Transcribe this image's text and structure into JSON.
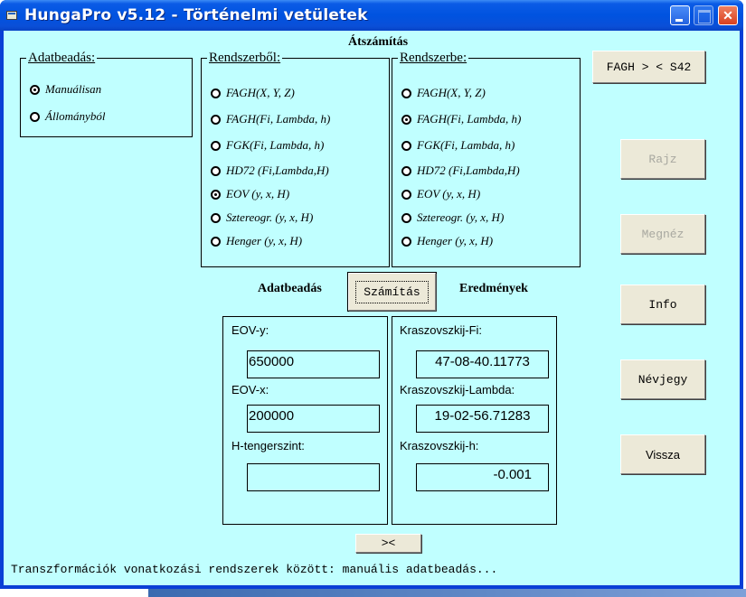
{
  "window": {
    "title": "HungaPro v5.12 - Történelmi vetületek",
    "controls": {
      "minimize": "minimize",
      "maximize": "maximize",
      "close": "close"
    }
  },
  "header": {
    "title": "Átszámítás"
  },
  "input_mode": {
    "legend": "Adatbeadás:",
    "options": [
      {
        "label": "Manuálisan",
        "checked": true
      },
      {
        "label": "Állományból",
        "checked": false
      }
    ]
  },
  "from_system": {
    "legend": "Rendszerből:",
    "options": [
      {
        "label": "FAGH(X, Y, Z)",
        "checked": false
      },
      {
        "label": "FAGH(Fi, Lambda, h)",
        "checked": false
      },
      {
        "label": "FGK(Fi, Lambda, h)",
        "checked": false
      },
      {
        "label": "HD72 (Fi,Lambda,H)",
        "checked": false
      },
      {
        "label": "EOV (y, x, H)",
        "checked": true
      },
      {
        "label": "Sztereogr. (y, x, H)",
        "checked": false
      },
      {
        "label": "Henger (y, x, H)",
        "checked": false
      }
    ]
  },
  "to_system": {
    "legend": "Rendszerbe:",
    "options": [
      {
        "label": "FAGH(X, Y, Z)",
        "checked": false
      },
      {
        "label": "FAGH(Fi, Lambda, h)",
        "checked": true
      },
      {
        "label": "FGK(Fi, Lambda, h)",
        "checked": false
      },
      {
        "label": "HD72 (Fi,Lambda,H)",
        "checked": false
      },
      {
        "label": "EOV (y, x, H)",
        "checked": false
      },
      {
        "label": "Sztereogr. (y, x, H)",
        "checked": false
      },
      {
        "label": "Henger (y, x, H)",
        "checked": false
      }
    ]
  },
  "side_buttons": {
    "fagh_s42": {
      "label": "FAGH > < S42",
      "enabled": true
    },
    "rajz": {
      "label": "Rajz",
      "enabled": false
    },
    "megnez": {
      "label": "Megnéz",
      "enabled": false
    },
    "info": {
      "label": "Info",
      "enabled": true
    },
    "nevjegy": {
      "label": "Névjegy",
      "enabled": true
    },
    "vissza": {
      "label": "Vissza",
      "enabled": true
    }
  },
  "compute": {
    "input_heading": "Adatbeadás",
    "button_label": "Számítás",
    "results_heading": "Eredmények",
    "swap_label": "><"
  },
  "inputs": [
    {
      "label": "EOV-y:",
      "value": "650000"
    },
    {
      "label": "EOV-x:",
      "value": "200000"
    },
    {
      "label": "H-tengerszint:",
      "value": ""
    }
  ],
  "results": [
    {
      "label": "Kraszovszkij-Fi:",
      "value": "47-08-40.11773"
    },
    {
      "label": "Kraszovszkij-Lambda:",
      "value": "19-02-56.71283"
    },
    {
      "label": "Kraszovszkij-h:",
      "value": "-0.001"
    }
  ],
  "status_text": "Transzformációk vonatkozási rendszerek között: manuális adatbeadás..."
}
